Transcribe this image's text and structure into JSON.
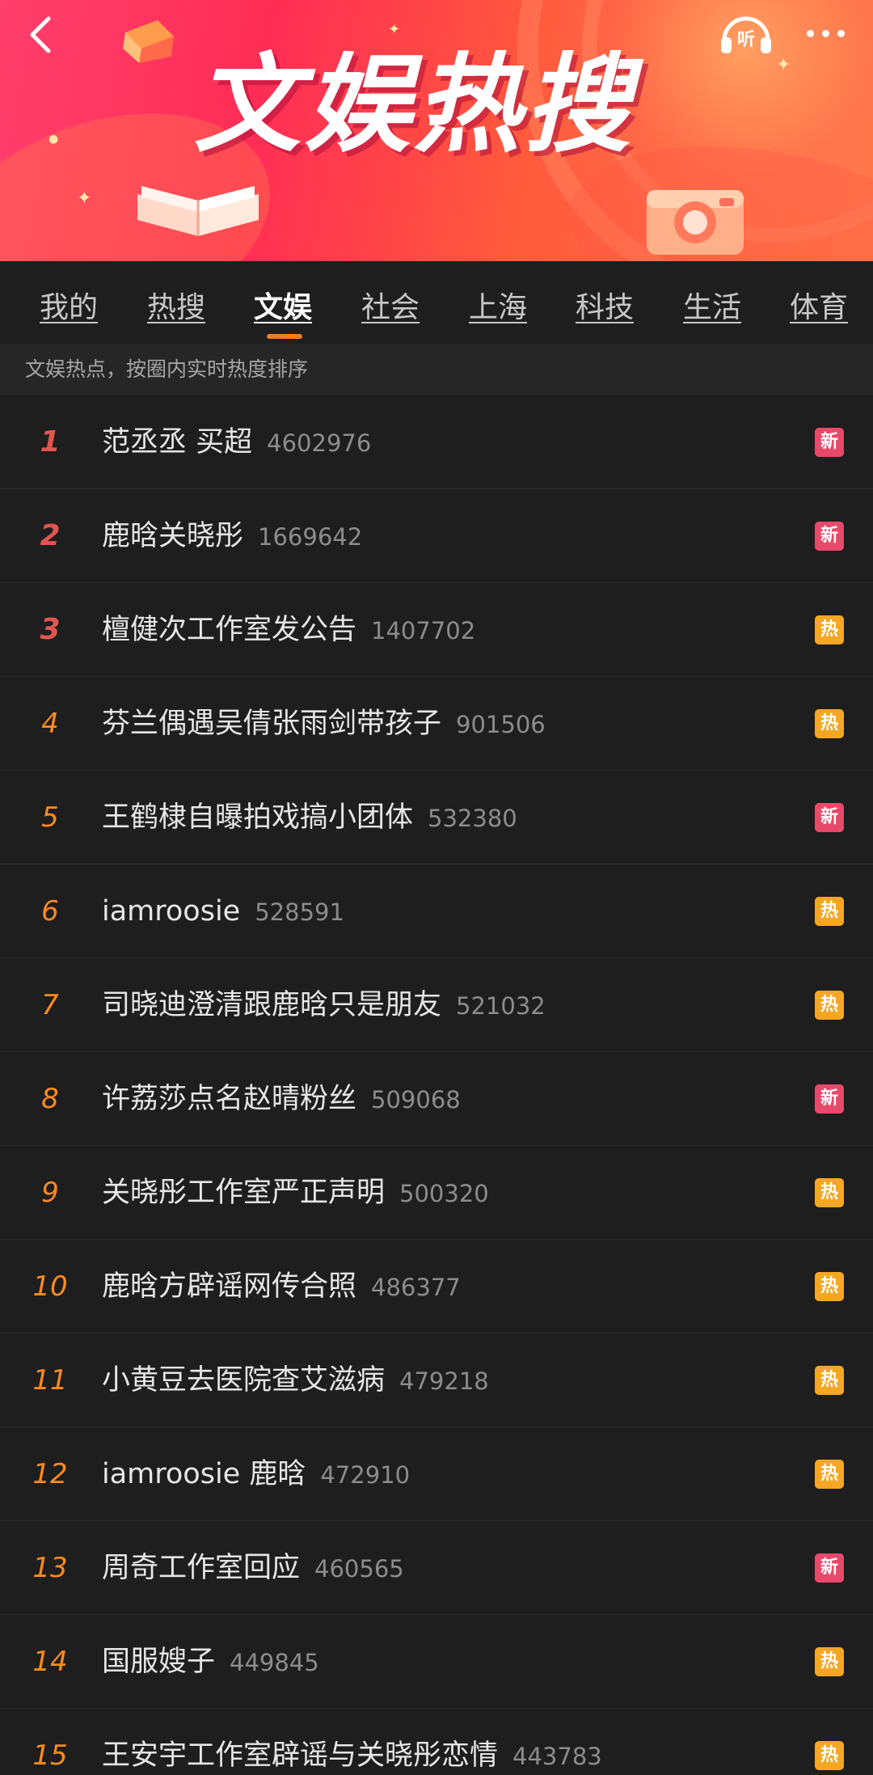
{
  "header": {
    "title": "文娱热搜",
    "listen_label": "听"
  },
  "tabs": [
    {
      "label": "我的"
    },
    {
      "label": "热搜"
    },
    {
      "label": "文娱",
      "active": true
    },
    {
      "label": "社会"
    },
    {
      "label": "上海"
    },
    {
      "label": "科技"
    },
    {
      "label": "生活"
    },
    {
      "label": "体育"
    }
  ],
  "subheader": "文娱热点，按圈内实时热度排序",
  "badge_labels": {
    "new": "新",
    "hot": "热"
  },
  "colors": {
    "accent": "#ff7b1c",
    "new_badge": "#e8496a",
    "hot_badge": "#f5a623",
    "top_rank": "#e2554f",
    "rank": "#ff8a1e"
  },
  "items": [
    {
      "rank": "1",
      "title": "范丞丞 买超",
      "heat": "4602976",
      "badge": "新",
      "badge_type": "new"
    },
    {
      "rank": "2",
      "title": "鹿晗关晓彤",
      "heat": "1669642",
      "badge": "新",
      "badge_type": "new"
    },
    {
      "rank": "3",
      "title": "檀健次工作室发公告",
      "heat": "1407702",
      "badge": "热",
      "badge_type": "hot"
    },
    {
      "rank": "4",
      "title": "芬兰偶遇吴倩张雨剑带孩子",
      "heat": "901506",
      "badge": "热",
      "badge_type": "hot"
    },
    {
      "rank": "5",
      "title": "王鹤棣自曝拍戏搞小团体",
      "heat": "532380",
      "badge": "新",
      "badge_type": "new"
    },
    {
      "rank": "6",
      "title": "iamroosie",
      "heat": "528591",
      "badge": "热",
      "badge_type": "hot"
    },
    {
      "rank": "7",
      "title": "司晓迪澄清跟鹿晗只是朋友",
      "heat": "521032",
      "badge": "热",
      "badge_type": "hot"
    },
    {
      "rank": "8",
      "title": "许荔莎点名赵晴粉丝",
      "heat": "509068",
      "badge": "新",
      "badge_type": "new"
    },
    {
      "rank": "9",
      "title": "关晓彤工作室严正声明",
      "heat": "500320",
      "badge": "热",
      "badge_type": "hot"
    },
    {
      "rank": "10",
      "title": "鹿晗方辟谣网传合照",
      "heat": "486377",
      "badge": "热",
      "badge_type": "hot"
    },
    {
      "rank": "11",
      "title": "小黄豆去医院查艾滋病",
      "heat": "479218",
      "badge": "热",
      "badge_type": "hot"
    },
    {
      "rank": "12",
      "title": "iamroosie 鹿晗",
      "heat": "472910",
      "badge": "热",
      "badge_type": "hot"
    },
    {
      "rank": "13",
      "title": "周奇工作室回应",
      "heat": "460565",
      "badge": "新",
      "badge_type": "new"
    },
    {
      "rank": "14",
      "title": "国服嫂子",
      "heat": "449845",
      "badge": "热",
      "badge_type": "hot"
    },
    {
      "rank": "15",
      "title": "王安宇工作室辟谣与关晓彤恋情",
      "heat": "443783",
      "badge": "热",
      "badge_type": "hot"
    }
  ]
}
